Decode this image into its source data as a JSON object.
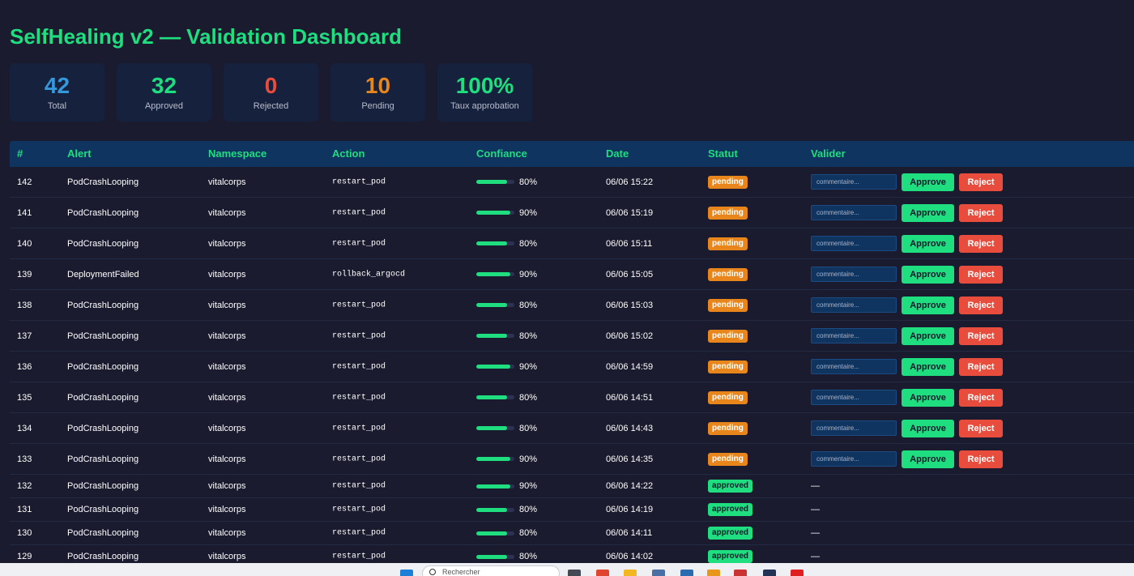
{
  "header": {
    "title": "SelfHealing v2 — Validation Dashboard"
  },
  "stats": [
    {
      "value": "42",
      "label": "Total",
      "color": "#3498db"
    },
    {
      "value": "32",
      "label": "Approved",
      "color": "#1ede7f"
    },
    {
      "value": "0",
      "label": "Rejected",
      "color": "#e74c3c"
    },
    {
      "value": "10",
      "label": "Pending",
      "color": "#e8861c"
    },
    {
      "value": "100%",
      "label": "Taux approbation",
      "color": "#1ede7f"
    }
  ],
  "table": {
    "headers": [
      "#",
      "Alert",
      "Namespace",
      "Action",
      "Confiance",
      "Date",
      "Statut",
      "Valider"
    ],
    "comment_placeholder": "commentaire...",
    "approve_label": "Approve",
    "reject_label": "Reject",
    "rows": [
      {
        "id": "142",
        "alert": "PodCrashLooping",
        "namespace": "vitalcorps",
        "action": "restart_pod",
        "confidence": 80,
        "confidence_label": "80%",
        "date": "06/06 15:22",
        "status": "pending"
      },
      {
        "id": "141",
        "alert": "PodCrashLooping",
        "namespace": "vitalcorps",
        "action": "restart_pod",
        "confidence": 90,
        "confidence_label": "90%",
        "date": "06/06 15:19",
        "status": "pending"
      },
      {
        "id": "140",
        "alert": "PodCrashLooping",
        "namespace": "vitalcorps",
        "action": "restart_pod",
        "confidence": 80,
        "confidence_label": "80%",
        "date": "06/06 15:11",
        "status": "pending"
      },
      {
        "id": "139",
        "alert": "DeploymentFailed",
        "namespace": "vitalcorps",
        "action": "rollback_argocd",
        "confidence": 90,
        "confidence_label": "90%",
        "date": "06/06 15:05",
        "status": "pending"
      },
      {
        "id": "138",
        "alert": "PodCrashLooping",
        "namespace": "vitalcorps",
        "action": "restart_pod",
        "confidence": 80,
        "confidence_label": "80%",
        "date": "06/06 15:03",
        "status": "pending"
      },
      {
        "id": "137",
        "alert": "PodCrashLooping",
        "namespace": "vitalcorps",
        "action": "restart_pod",
        "confidence": 80,
        "confidence_label": "80%",
        "date": "06/06 15:02",
        "status": "pending"
      },
      {
        "id": "136",
        "alert": "PodCrashLooping",
        "namespace": "vitalcorps",
        "action": "restart_pod",
        "confidence": 90,
        "confidence_label": "90%",
        "date": "06/06 14:59",
        "status": "pending"
      },
      {
        "id": "135",
        "alert": "PodCrashLooping",
        "namespace": "vitalcorps",
        "action": "restart_pod",
        "confidence": 80,
        "confidence_label": "80%",
        "date": "06/06 14:51",
        "status": "pending"
      },
      {
        "id": "134",
        "alert": "PodCrashLooping",
        "namespace": "vitalcorps",
        "action": "restart_pod",
        "confidence": 80,
        "confidence_label": "80%",
        "date": "06/06 14:43",
        "status": "pending"
      },
      {
        "id": "133",
        "alert": "PodCrashLooping",
        "namespace": "vitalcorps",
        "action": "restart_pod",
        "confidence": 90,
        "confidence_label": "90%",
        "date": "06/06 14:35",
        "status": "pending"
      },
      {
        "id": "132",
        "alert": "PodCrashLooping",
        "namespace": "vitalcorps",
        "action": "restart_pod",
        "confidence": 90,
        "confidence_label": "90%",
        "date": "06/06 14:22",
        "status": "approved",
        "validated": "—"
      },
      {
        "id": "131",
        "alert": "PodCrashLooping",
        "namespace": "vitalcorps",
        "action": "restart_pod",
        "confidence": 80,
        "confidence_label": "80%",
        "date": "06/06 14:19",
        "status": "approved",
        "validated": "—"
      },
      {
        "id": "130",
        "alert": "PodCrashLooping",
        "namespace": "vitalcorps",
        "action": "restart_pod",
        "confidence": 80,
        "confidence_label": "80%",
        "date": "06/06 14:11",
        "status": "approved",
        "validated": "—"
      },
      {
        "id": "129",
        "alert": "PodCrashLooping",
        "namespace": "vitalcorps",
        "action": "restart_pod",
        "confidence": 80,
        "confidence_label": "80%",
        "date": "06/06 14:02",
        "status": "approved",
        "validated": "—"
      }
    ]
  },
  "taskbar": {
    "search_text": "Rechercher",
    "icons": [
      "windows-icon",
      "task-view-icon",
      "chrome-icon",
      "file-explorer-icon",
      "settings-icon",
      "app-icon",
      "folder-icon",
      "app-icon-2",
      "terminal-icon",
      "opera-icon"
    ]
  }
}
